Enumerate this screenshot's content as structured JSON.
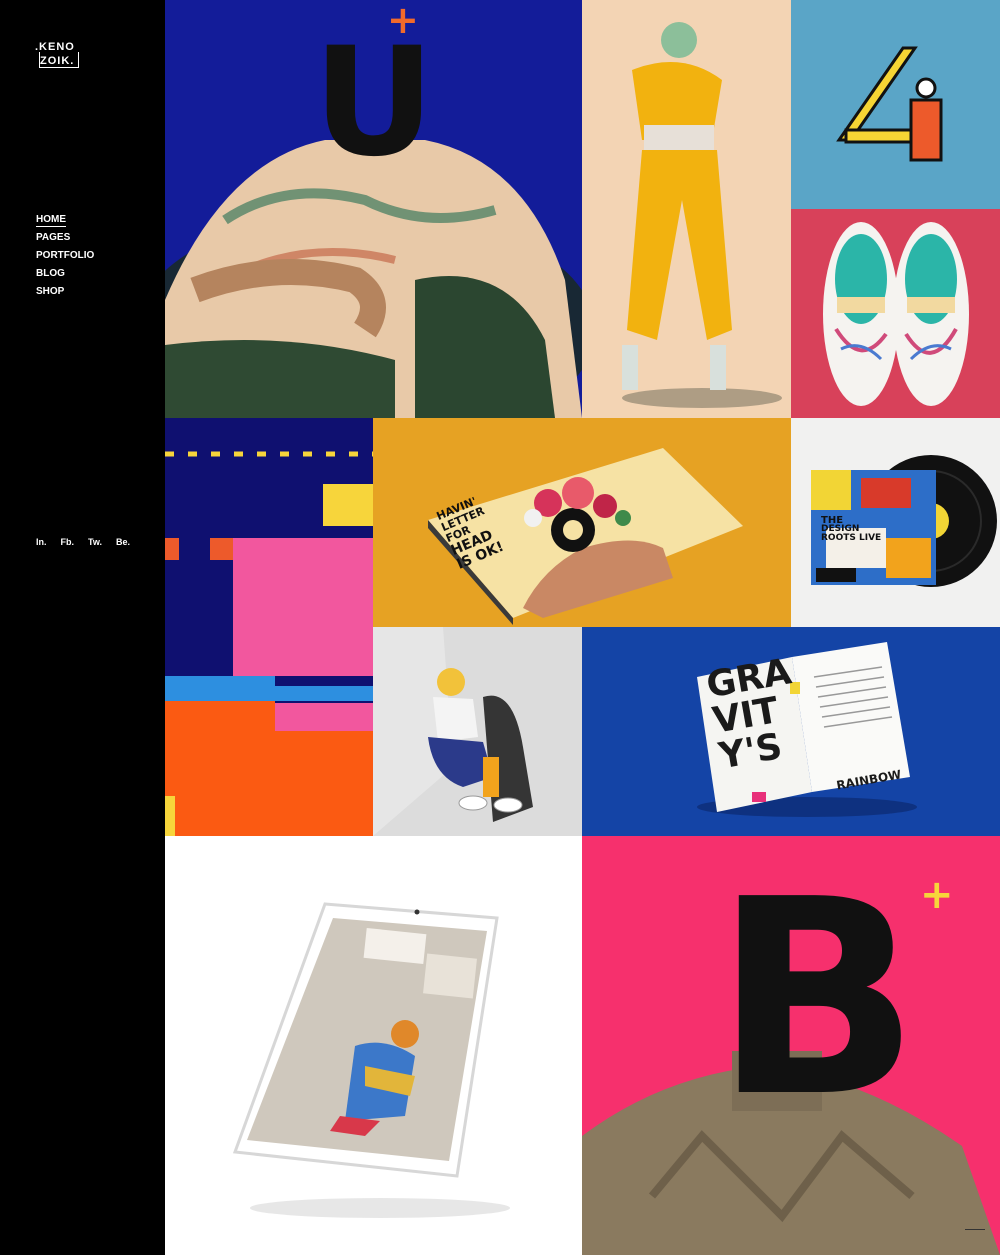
{
  "brand": {
    "logo_line1": ".KENO",
    "logo_line2": "ZOIK."
  },
  "nav": {
    "items": [
      {
        "label": "HOME",
        "active": true
      },
      {
        "label": "PAGES",
        "active": false
      },
      {
        "label": "PORTFOLIO",
        "active": false
      },
      {
        "label": "BLOG",
        "active": false
      },
      {
        "label": "SHOP",
        "active": false
      }
    ]
  },
  "social": {
    "instagram": "In.",
    "facebook": "Fb.",
    "twitter": "Tw.",
    "behance": "Be."
  },
  "portfolio": {
    "u_tile": {
      "letter": "U",
      "plus": "+"
    },
    "four_tile": {
      "glyph": "4"
    },
    "book_tile": {
      "line1": "HAVIN'",
      "line2": "LETTER",
      "line3": "FOR",
      "line4": "HEAD",
      "line5": "IS OK!"
    },
    "vinyl_tile": {
      "line1": "THE",
      "line2": "DESIGN",
      "line3": "ROOTS LIVE"
    },
    "magazine_tile": {
      "line1": "GRA",
      "line2": "VIT",
      "line3": "Y'S",
      "caption": "RAINBOW"
    },
    "b_tile": {
      "letter": "B",
      "plus": "+"
    }
  },
  "colors": {
    "sidebar": "#000000",
    "accent_orange": "#f26a2b",
    "accent_yellow": "#f7d53b",
    "pink": "#f6306d",
    "deep_blue": "#131c99"
  }
}
